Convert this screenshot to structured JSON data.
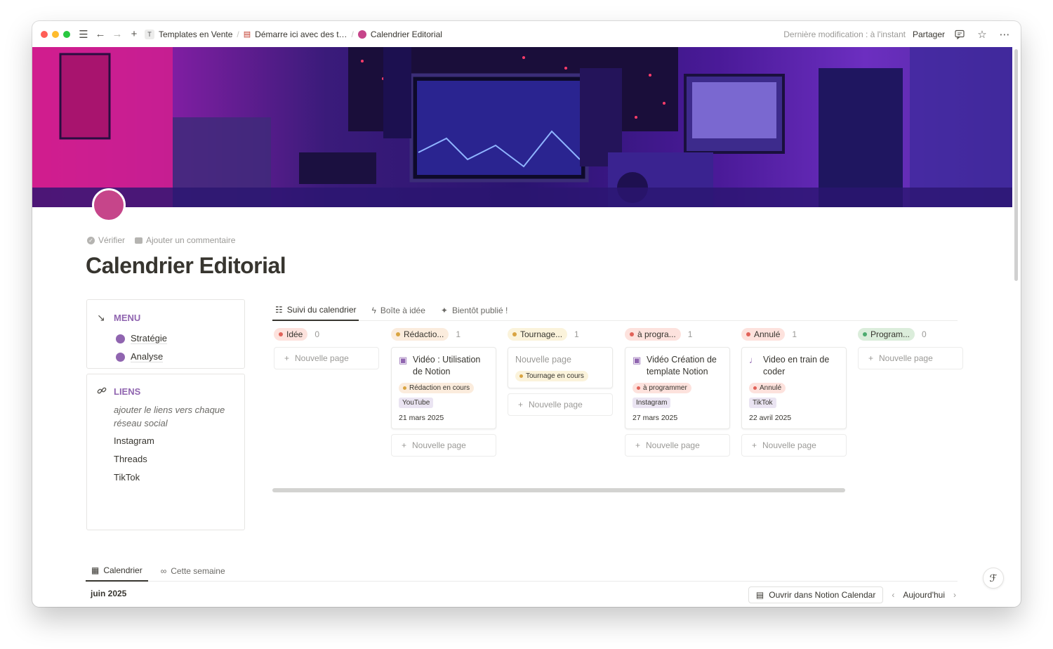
{
  "topbar": {
    "breadcrumbs": [
      {
        "label": "Templates en Vente",
        "badge": "T"
      },
      {
        "label": "Démarre ici avec des t…"
      },
      {
        "label": "Calendrier Editorial"
      }
    ],
    "last_modified": "Dernière modification : à l'instant",
    "share": "Partager"
  },
  "page": {
    "actions": {
      "verify": "Vérifier",
      "comment": "Ajouter un commentaire"
    },
    "title": "Calendrier Editorial",
    "icon_color": "#c6458a"
  },
  "menu": {
    "title": "MENU",
    "items": [
      {
        "label": "Stratégie"
      },
      {
        "label": "Analyse"
      }
    ]
  },
  "links": {
    "title": "LIENS",
    "note": "ajouter le liens vers chaque réseau social",
    "items": [
      {
        "label": "Instagram"
      },
      {
        "label": "Threads"
      },
      {
        "label": "TikTok"
      }
    ]
  },
  "tabs": [
    {
      "label": "Suivi du calendrier",
      "icon": "checklist-icon"
    },
    {
      "label": "Boîte à idée",
      "icon": "lightning-icon"
    },
    {
      "label": "Bientôt publié !",
      "icon": "party-icon"
    }
  ],
  "board": {
    "new_page": "Nouvelle page",
    "columns": [
      {
        "label": "Idée",
        "count": "0",
        "bg": "#fde2dd",
        "dot": "#e16259"
      },
      {
        "label": "Rédactio...",
        "count": "1",
        "bg": "#fbecdd",
        "dot": "#d9a441",
        "card": {
          "title": "Vidéo : Utilisation de Notion",
          "status": "Rédaction en cours",
          "platform": "YouTube",
          "date": "21 mars 2025"
        }
      },
      {
        "label": "Tournage...",
        "count": "1",
        "bg": "#fbf3db",
        "dot": "#d9a441",
        "card": {
          "title": "Nouvelle page",
          "status": "Tournage en cours"
        }
      },
      {
        "label": "à progra...",
        "count": "1",
        "bg": "#fde2dd",
        "dot": "#e16259",
        "card": {
          "title": "Vidéo Création de template Notion",
          "status": "à programmer",
          "platform": "Instagram",
          "date": "27 mars 2025"
        }
      },
      {
        "label": "Annulé",
        "count": "1",
        "bg": "#fde2dd",
        "dot": "#e16259",
        "card": {
          "title": "Video en train de coder",
          "status": "Annulé",
          "platform": "TikTok",
          "date": "22 avril 2025"
        }
      },
      {
        "label": "Program...",
        "count": "0",
        "bg": "#dbeddb",
        "dot": "#4dab6f"
      }
    ]
  },
  "bottom_tabs": [
    {
      "label": "Calendrier",
      "icon": "calendar-icon"
    },
    {
      "label": "Cette semaine",
      "icon": "binoculars-icon"
    }
  ],
  "calendar": {
    "month": "juin 2025",
    "open_label": "Ouvrir dans Notion Calendar",
    "today": "Aujourd'hui"
  }
}
